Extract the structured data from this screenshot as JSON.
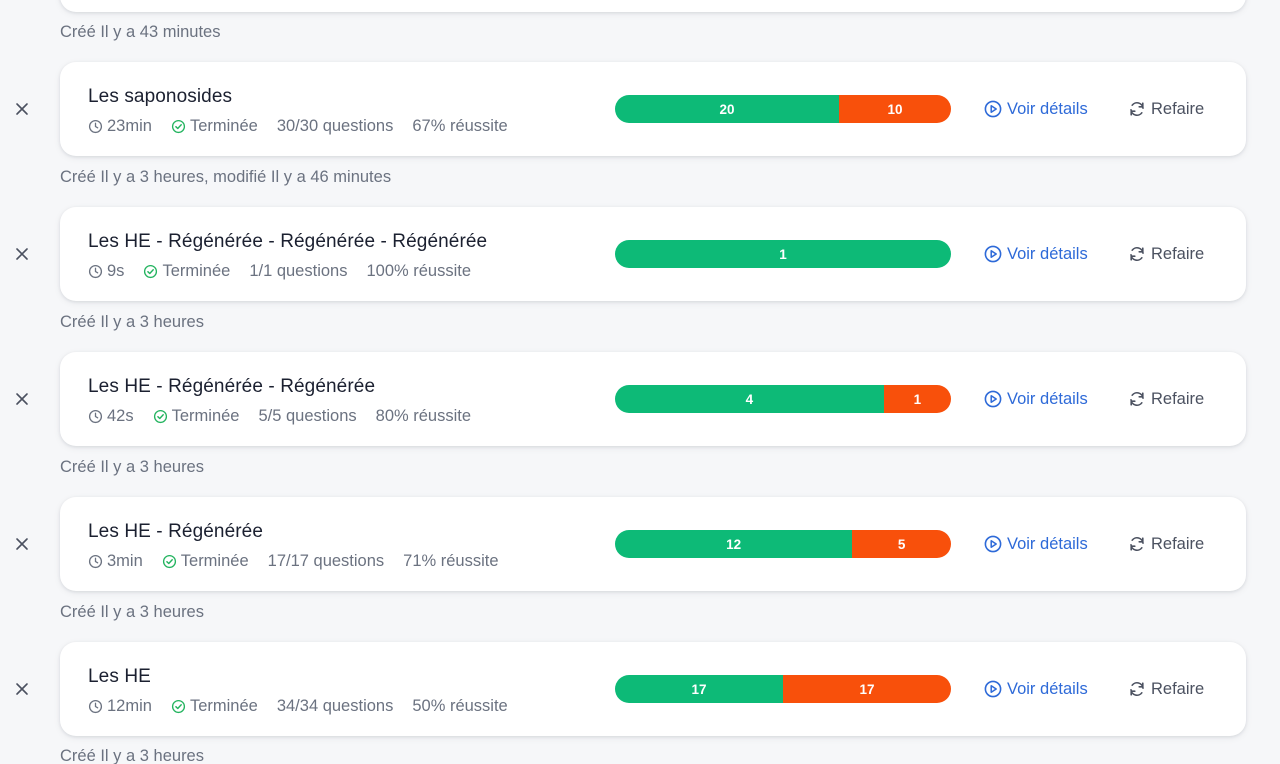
{
  "top_created": "Créé Il y a 43 minutes",
  "actions": {
    "details_label": "Voir détails",
    "redo_label": "Refaire"
  },
  "colors": {
    "correct": "#0dba77",
    "wrong": "#f8500b",
    "link": "#2e6ad8"
  },
  "sessions": [
    {
      "title": "Les saponosides",
      "duration": "23min",
      "status": "Terminée",
      "questions": "30/30 questions",
      "success": "67% réussite",
      "correct": 20,
      "wrong": 10,
      "correct_label": "20",
      "wrong_label": "10",
      "created": "Créé Il y a 3 heures, modifié Il y a 46 minutes"
    },
    {
      "title": "Les HE - Régénérée - Régénérée - Régénérée",
      "duration": "9s",
      "status": "Terminée",
      "questions": "1/1 questions",
      "success": "100% réussite",
      "correct": 1,
      "wrong": 0,
      "correct_label": "1",
      "wrong_label": "",
      "created": "Créé Il y a 3 heures"
    },
    {
      "title": "Les HE - Régénérée - Régénérée",
      "duration": "42s",
      "status": "Terminée",
      "questions": "5/5 questions",
      "success": "80% réussite",
      "correct": 4,
      "wrong": 1,
      "correct_label": "4",
      "wrong_label": "1",
      "created": "Créé Il y a 3 heures"
    },
    {
      "title": "Les HE - Régénérée",
      "duration": "3min",
      "status": "Terminée",
      "questions": "17/17 questions",
      "success": "71% réussite",
      "correct": 12,
      "wrong": 5,
      "correct_label": "12",
      "wrong_label": "5",
      "created": "Créé Il y a 3 heures"
    },
    {
      "title": "Les HE",
      "duration": "12min",
      "status": "Terminée",
      "questions": "34/34 questions",
      "success": "50% réussite",
      "correct": 17,
      "wrong": 17,
      "correct_label": "17",
      "wrong_label": "17",
      "created": "Créé Il y a 3 heures"
    }
  ]
}
